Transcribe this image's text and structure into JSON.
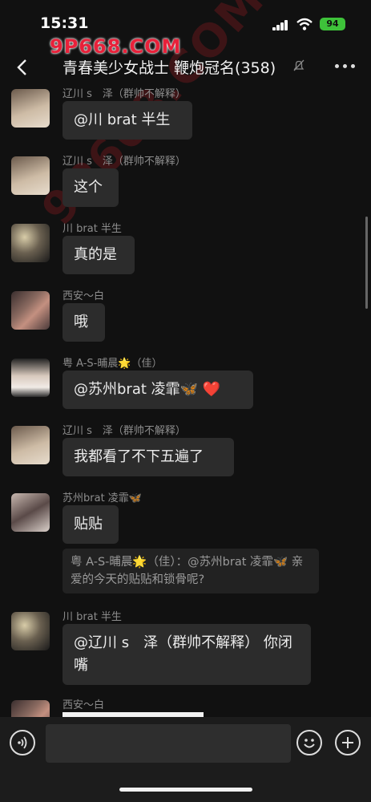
{
  "status_bar": {
    "time": "15:31",
    "battery": "94"
  },
  "watermark": {
    "top": "9P668.COM",
    "diagonal": "9P668.COM"
  },
  "header": {
    "title": "青春美少女战士 鞭炮冠名(358)",
    "back_icon": "chevron-left-icon",
    "mute_icon": "bell-slash-icon",
    "more_icon": "ellipsis-icon"
  },
  "messages": [
    {
      "sender": "辽川 s　泽（群帅不解释）",
      "text": "@川 brat 半生"
    },
    {
      "sender": "辽川 s　泽（群帅不解释）",
      "text": "这个"
    },
    {
      "sender": "川 brat 半生",
      "text": "真的是"
    },
    {
      "sender": "西安～白",
      "text": "哦"
    },
    {
      "sender": "粤 A-S-晡晨🌟（佳）",
      "text": "@苏州brat 凌霏🦋 ❤️"
    },
    {
      "sender": "辽川 s　泽（群帅不解释）",
      "text": "我都看了不下五遍了"
    },
    {
      "sender": "苏州brat 凌霏🦋",
      "text": "贴贴",
      "quote": "粤 A-S-晡晨🌟（佳）：@苏州brat 凌霏🦋 亲爱的今天的贴贴和锁骨呢?"
    },
    {
      "sender": "川 brat 半生",
      "text": "@辽川 s　泽（群帅不解释） 你闭嘴"
    },
    {
      "sender": "西安～白",
      "text": ""
    }
  ],
  "input_bar": {
    "voice_icon": "voice-icon",
    "emoji_icon": "smile-icon",
    "plus_icon": "plus-icon"
  }
}
